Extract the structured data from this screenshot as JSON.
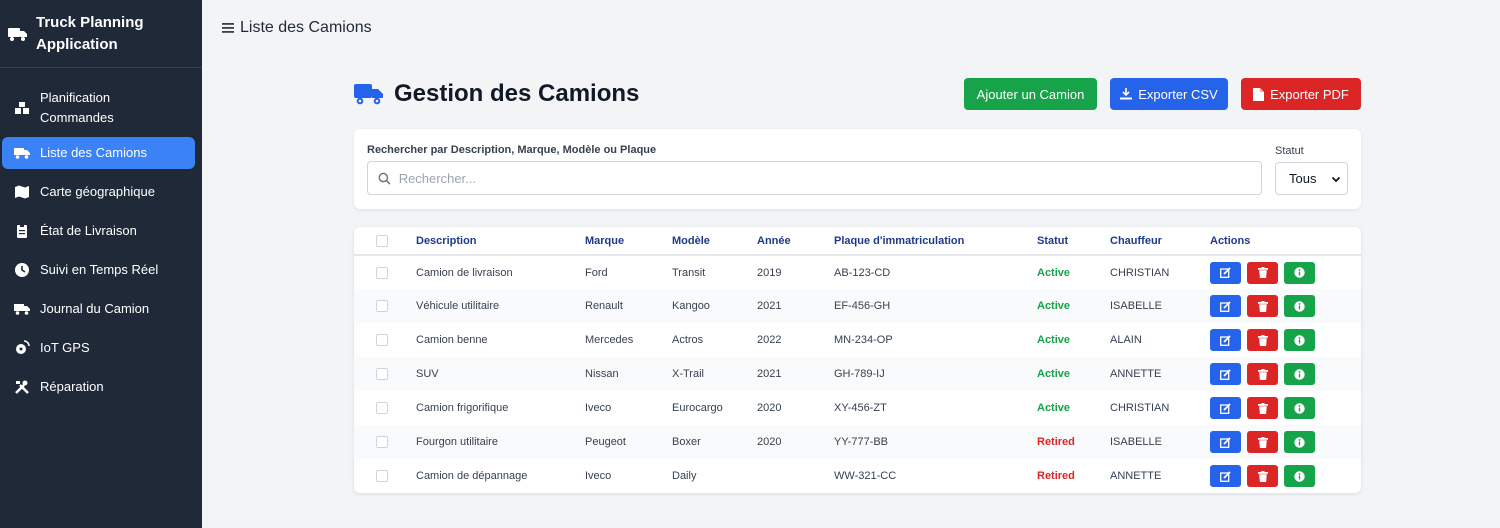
{
  "app": {
    "title": "Truck Planning Application"
  },
  "sidebar": {
    "items": [
      {
        "label": "Planification Commandes",
        "icon": "boxes-icon"
      },
      {
        "label": "Liste des Camions",
        "icon": "truck-icon",
        "active": true
      },
      {
        "label": "Carte géographique",
        "icon": "map-icon"
      },
      {
        "label": "État de Livraison",
        "icon": "clipboard-icon"
      },
      {
        "label": "Suivi en Temps Réel",
        "icon": "clock-icon"
      },
      {
        "label": "Journal du Camion",
        "icon": "truck-icon"
      },
      {
        "label": "IoT GPS",
        "icon": "satellite-icon"
      },
      {
        "label": "Réparation",
        "icon": "tools-icon"
      }
    ]
  },
  "topbar": {
    "title": "Liste des Camions"
  },
  "main": {
    "title": "Gestion des Camions",
    "buttons": {
      "add": "Ajouter un Camion",
      "csv": "Exporter CSV",
      "pdf": "Exporter PDF"
    }
  },
  "filters": {
    "search_label": "Rechercher par Description, Marque, Modèle ou Plaque",
    "search_placeholder": "Rechercher...",
    "search_value": "",
    "status_label": "Statut",
    "status_value": "Tous"
  },
  "table": {
    "headers": [
      "Description",
      "Marque",
      "Modèle",
      "Année",
      "Plaque d'immatriculation",
      "Statut",
      "Chauffeur",
      "Actions"
    ],
    "rows": [
      {
        "description": "Camion de livraison",
        "brand": "Ford",
        "model": "Transit",
        "year": "2019",
        "plate": "AB-123-CD",
        "status": "Active",
        "driver": "CHRISTIAN"
      },
      {
        "description": "Véhicule utilitaire",
        "brand": "Renault",
        "model": "Kangoo",
        "year": "2021",
        "plate": "EF-456-GH",
        "status": "Active",
        "driver": "ISABELLE"
      },
      {
        "description": "Camion benne",
        "brand": "Mercedes",
        "model": "Actros",
        "year": "2022",
        "plate": "MN-234-OP",
        "status": "Active",
        "driver": "ALAIN"
      },
      {
        "description": "SUV",
        "brand": "Nissan",
        "model": "X-Trail",
        "year": "2021",
        "plate": "GH-789-IJ",
        "status": "Active",
        "driver": "ANNETTE"
      },
      {
        "description": "Camion frigorifique",
        "brand": "Iveco",
        "model": "Eurocargo",
        "year": "2020",
        "plate": "XY-456-ZT",
        "status": "Active",
        "driver": "CHRISTIAN"
      },
      {
        "description": "Fourgon utilitaire",
        "brand": "Peugeot",
        "model": "Boxer",
        "year": "2020",
        "plate": "YY-777-BB",
        "status": "Retired",
        "driver": "ISABELLE"
      },
      {
        "description": "Camion de dépannage",
        "brand": "Iveco",
        "model": "Daily",
        "year": "",
        "plate": "WW-321-CC",
        "status": "Retired",
        "driver": "ANNETTE"
      }
    ]
  },
  "colors": {
    "sidebar_bg": "#1f2937",
    "active": "#3b82f6",
    "green": "#16a34a",
    "blue": "#2563eb",
    "red": "#dc2626"
  }
}
